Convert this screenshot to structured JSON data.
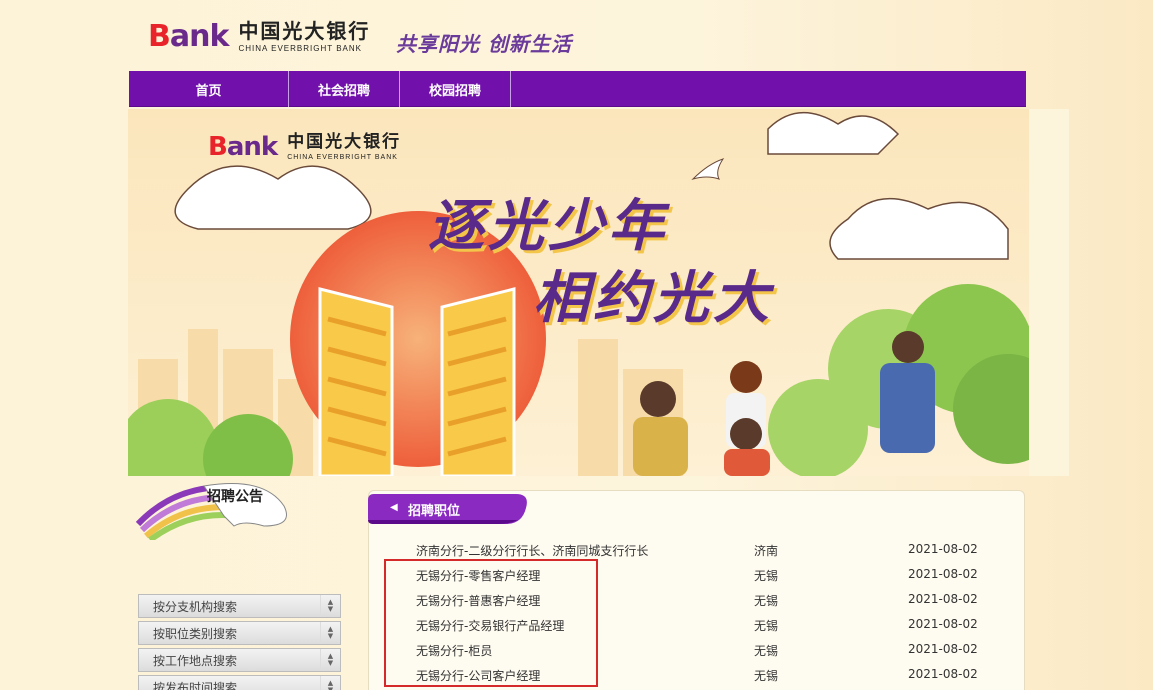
{
  "header": {
    "logo_bank_b": "B",
    "logo_bank_rest": "ank",
    "logo_cn": "中国光大银行",
    "logo_en": "CHINA EVERBRIGHT BANK",
    "slogan": "共享阳光 创新生活"
  },
  "nav": {
    "home": "首页",
    "social": "社会招聘",
    "campus": "校园招聘"
  },
  "banner": {
    "logo_cn": "中国光大银行",
    "logo_en": "CHINA EVERBRIGHT BANK",
    "title_line1": "逐光少年",
    "title_line2": "相约光大"
  },
  "sidebar": {
    "notice_title": "招聘公告",
    "search_items": [
      {
        "label": "按分支机构搜索"
      },
      {
        "label": "按职位类别搜索"
      },
      {
        "label": "按工作地点搜索"
      },
      {
        "label": "按发布时间搜索"
      }
    ]
  },
  "jobs": {
    "tab_label": "招聘职位",
    "rows": [
      {
        "title": "济南分行-二级分行行长、济南同城支行行长",
        "location": "济南",
        "date": "2021-08-02"
      },
      {
        "title": "无锡分行-零售客户经理",
        "location": "无锡",
        "date": "2021-08-02"
      },
      {
        "title": "无锡分行-普惠客户经理",
        "location": "无锡",
        "date": "2021-08-02"
      },
      {
        "title": "无锡分行-交易银行产品经理",
        "location": "无锡",
        "date": "2021-08-02"
      },
      {
        "title": "无锡分行-柜员",
        "location": "无锡",
        "date": "2021-08-02"
      },
      {
        "title": "无锡分行-公司客户经理",
        "location": "无锡",
        "date": "2021-08-02"
      }
    ]
  },
  "colors": {
    "nav_purple": "#7210ab",
    "brand_red": "#e8232a",
    "brand_purple": "#6a2a8c",
    "highlight_red": "#d42a2a"
  }
}
